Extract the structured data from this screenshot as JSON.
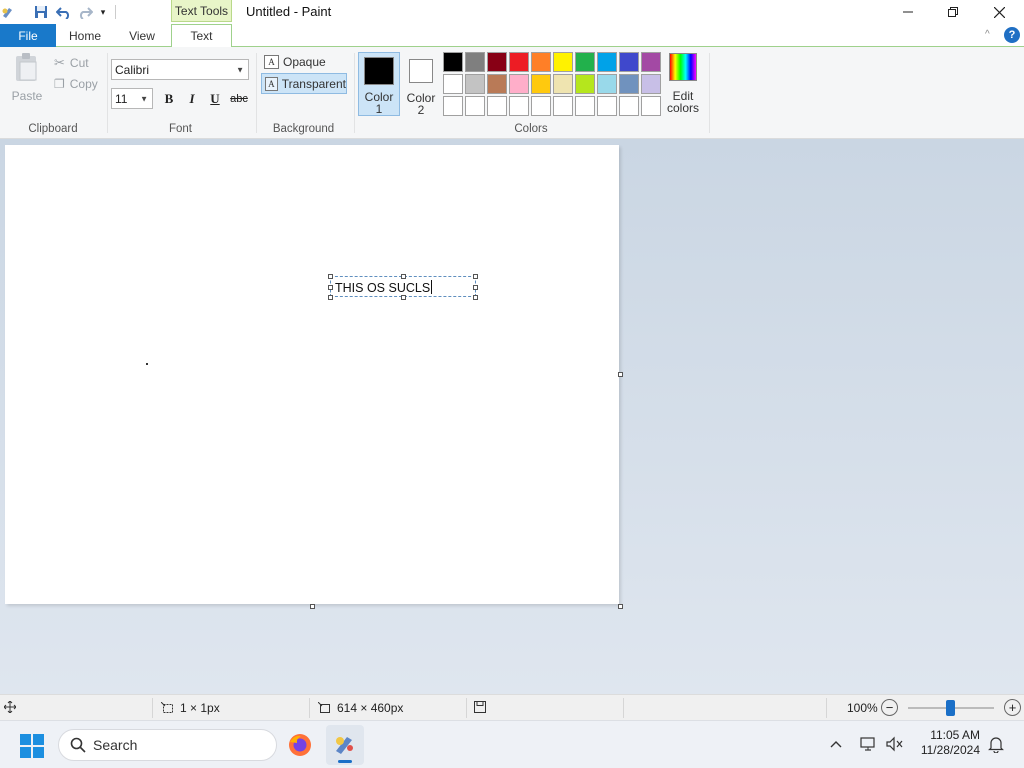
{
  "window": {
    "title": "Untitled - Paint",
    "contextual_tab": "Text Tools",
    "controls": [
      "minimize",
      "maximize",
      "close"
    ]
  },
  "tabs": [
    {
      "label": "File",
      "active": false
    },
    {
      "label": "Home",
      "active": false
    },
    {
      "label": "View",
      "active": false
    },
    {
      "label": "Text",
      "active": true
    }
  ],
  "ribbon": {
    "clipboard": {
      "paste": "Paste",
      "cut": "Cut",
      "copy": "Copy",
      "group": "Clipboard"
    },
    "font": {
      "family": "Calibri",
      "size": "11",
      "bold": "B",
      "italic": "I",
      "underline": "U",
      "strike": "abc",
      "group": "Font"
    },
    "background": {
      "opaque": "Opaque",
      "transparent": "Transparent",
      "selected": "Transparent",
      "group": "Background"
    },
    "colors": {
      "color1_label": "Color 1",
      "color1_value": "#000000",
      "color2_label": "Color 2",
      "color2_value": "#ffffff",
      "edit_label": "Edit colors",
      "group": "Colors",
      "palette": [
        "#000000",
        "#7f7f7f",
        "#880015",
        "#ed1c24",
        "#ff7f27",
        "#fff200",
        "#22b14c",
        "#00a2e8",
        "#3f48cc",
        "#a349a4",
        "#ffffff",
        "#c3c3c3",
        "#b97a57",
        "#ffaec9",
        "#ffc90e",
        "#efe4b0",
        "#b5e61d",
        "#99d9ea",
        "#7092be",
        "#c8bfe7",
        "#ffffff",
        "#ffffff",
        "#ffffff",
        "#ffffff",
        "#ffffff",
        "#ffffff",
        "#ffffff",
        "#ffffff",
        "#ffffff",
        "#ffffff"
      ]
    }
  },
  "canvas": {
    "typed_text": "THIS OS SUCLS"
  },
  "status": {
    "selection_size": "1 × 1px",
    "canvas_size": "614 × 460px",
    "zoom": "100%"
  },
  "taskbar": {
    "search_placeholder": "Search",
    "time": "11:05 AM",
    "date": "11/28/2024"
  }
}
